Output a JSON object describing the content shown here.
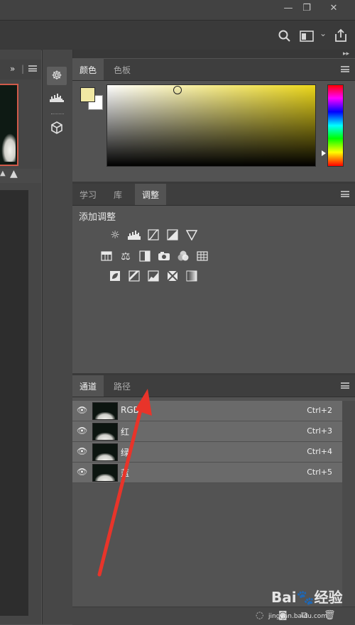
{
  "window": {
    "minimize_glyph": "—",
    "restore_glyph": "❐",
    "close_glyph": "✕"
  },
  "optionsbar": {
    "search_icon": "search-icon",
    "workspace_icon": "workspace-icon",
    "chevron": "⌄",
    "share_icon": "share-icon"
  },
  "left_panel": {
    "expand_glyph": "»",
    "divider": "|",
    "mountain_glyph": "▲"
  },
  "collapse": {
    "left": "◂◂",
    "right": "▸▸"
  },
  "tools": [
    {
      "name": "navigator-icon",
      "glyph": "☸"
    },
    {
      "name": "histogram-icon",
      "glyph": "▟"
    },
    {
      "name": "3d-icon",
      "glyph": "◫"
    }
  ],
  "color_panel": {
    "tabs": [
      "颜色",
      "色板"
    ],
    "active_tab": 0,
    "foreground": "#f1e8a3",
    "background": "#ffffff",
    "hue": "#ecd71a"
  },
  "adjust_panel": {
    "tabs": [
      "学习",
      "库",
      "调整"
    ],
    "active_tab": 2,
    "heading": "添加调整",
    "rows": [
      [
        {
          "name": "brightness-contrast-icon",
          "glyph": "☼"
        },
        {
          "name": "levels-icon",
          "glyph": "▟"
        },
        {
          "name": "curves-icon",
          "glyph": "▦"
        },
        {
          "name": "exposure-icon",
          "glyph": "◩"
        },
        {
          "name": "vibrance-icon",
          "glyph": "▽"
        }
      ],
      [
        {
          "name": "hue-saturation-icon",
          "glyph": "▤"
        },
        {
          "name": "color-balance-icon",
          "glyph": "⚖"
        },
        {
          "name": "black-white-icon",
          "glyph": "◧"
        },
        {
          "name": "photo-filter-icon",
          "glyph": "◉"
        },
        {
          "name": "channel-mixer-icon",
          "glyph": "❂"
        },
        {
          "name": "color-lookup-icon",
          "glyph": "▦"
        }
      ],
      [
        {
          "name": "invert-icon",
          "glyph": "◪"
        },
        {
          "name": "posterize-icon",
          "glyph": "▧"
        },
        {
          "name": "threshold-icon",
          "glyph": "◭"
        },
        {
          "name": "selective-color-icon",
          "glyph": "⊠"
        },
        {
          "name": "gradient-map-icon",
          "glyph": "▥"
        }
      ]
    ]
  },
  "channels_panel": {
    "tabs": [
      "通道",
      "路径"
    ],
    "active_tab": 0,
    "eye_glyph": "👁",
    "channels": [
      {
        "name": "RGB",
        "shortcut": "Ctrl+2"
      },
      {
        "name": "红",
        "shortcut": "Ctrl+3"
      },
      {
        "name": "绿",
        "shortcut": "Ctrl+4"
      },
      {
        "name": "蓝",
        "shortcut": "Ctrl+5"
      }
    ],
    "bottom_icons": [
      {
        "name": "load-selection-icon",
        "glyph": "◌"
      },
      {
        "name": "save-selection-icon",
        "glyph": "◙"
      },
      {
        "name": "new-channel-icon",
        "glyph": "⧉"
      },
      {
        "name": "delete-channel-icon",
        "glyph": "🗑"
      }
    ]
  },
  "annotation": {
    "color": "#e8342a"
  },
  "watermark": {
    "brand": "Bai🐾经验",
    "url": "jingyan.baidu.com"
  }
}
